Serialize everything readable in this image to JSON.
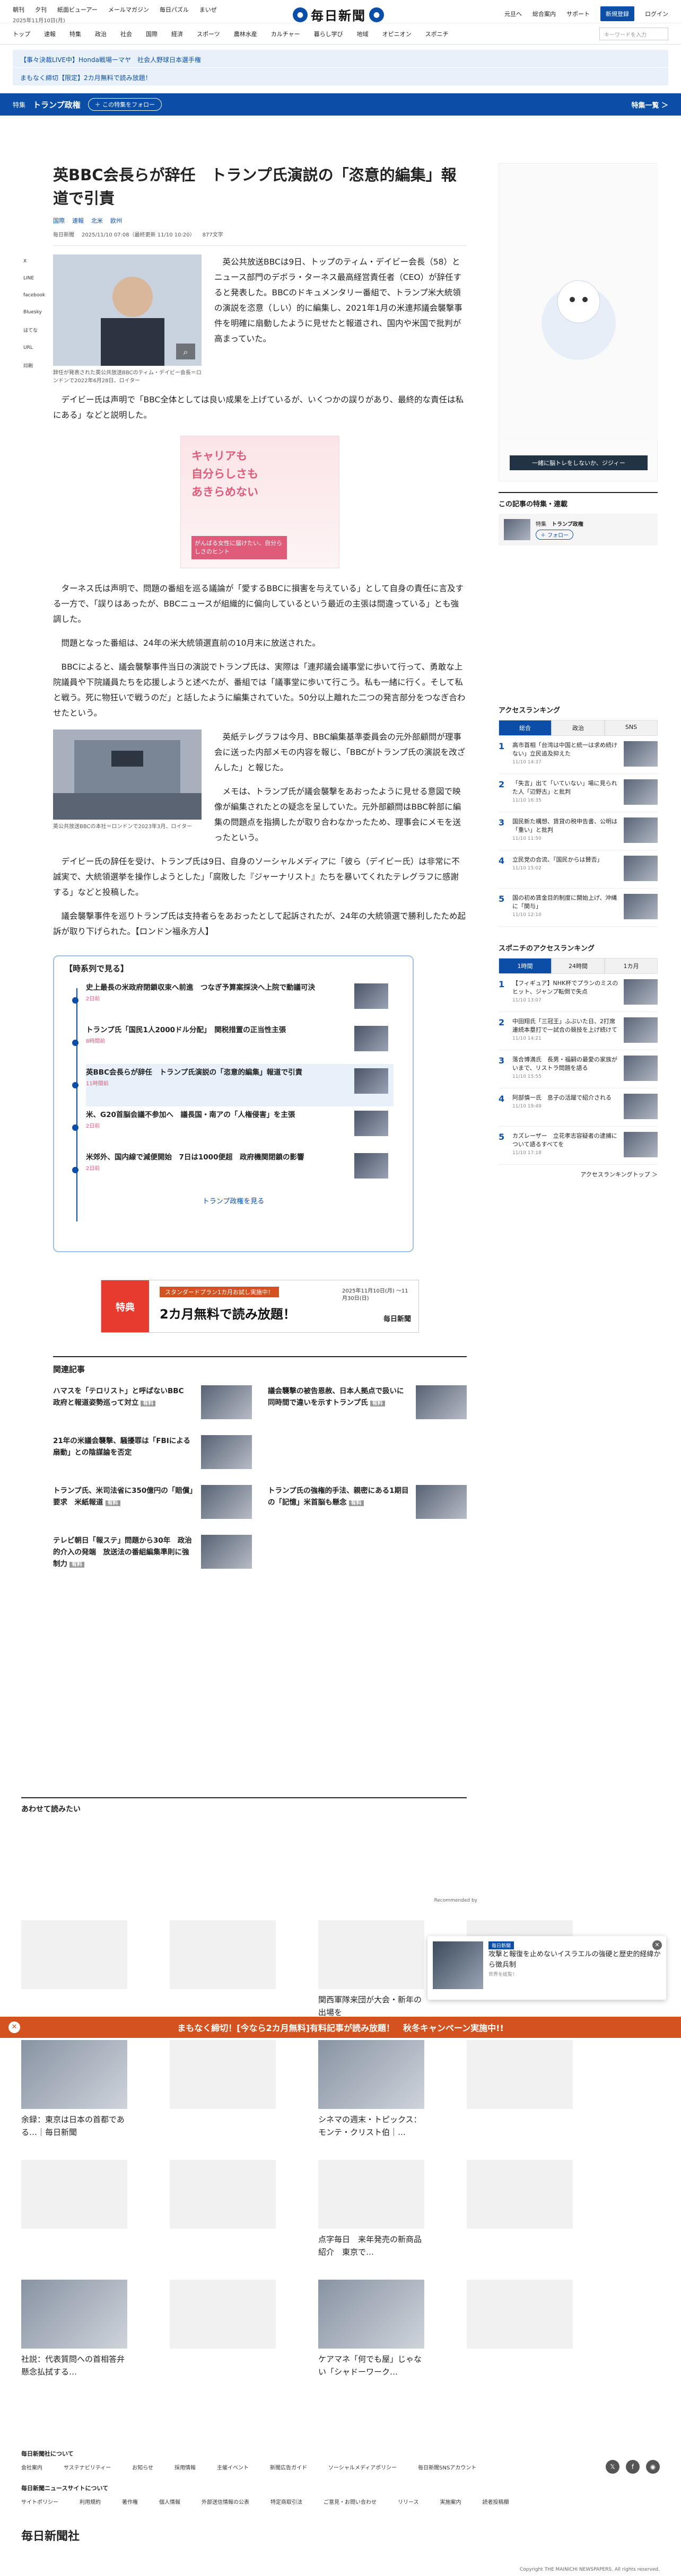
{
  "header": {
    "util_links": [
      "朝刊",
      "夕刊",
      "紙面ビューアー",
      "メールマガジン",
      "毎日パズル",
      "まいぜ"
    ],
    "date": "2025年11月10日(月)",
    "logo": "毎日新聞",
    "right_links": [
      "元旦へ",
      "総合案内",
      "サポート"
    ],
    "subscribe": "新規登録",
    "login": "ログイン"
  },
  "nav": {
    "items": [
      "トップ",
      "速報",
      "特集",
      "政治",
      "社会",
      "国際",
      "経済",
      "スポーツ",
      "農林水産",
      "カルチャー",
      "暮らし学び",
      "地域",
      "オピニオン",
      "スポニチ"
    ],
    "search_placeholder": "キーワードを入力"
  },
  "banners": [
    "【事々決裁LIVE中】Honda戦場ーマヤ　社会人野球日本選手権",
    "まもなく締切【限定】2カ月無料で読み放題！"
  ],
  "feature": {
    "tag": "特集",
    "title": "トランプ政権",
    "follow": "＋ この特集をフォロー",
    "more": "特集一覧 ＞"
  },
  "article": {
    "title": "英BBC会長らが辞任　トランプ氏演説の「恣意的編集」報道で引責",
    "categories": [
      "国際",
      "速報",
      "北米",
      "欧州"
    ],
    "meta": [
      "毎日新聞",
      "2025/11/10 07:08（最終更新 11/10 10:20）",
      "877文字"
    ],
    "share_icons": [
      "X",
      "LINE",
      "facebook",
      "Bluesky",
      "はてな",
      "URL",
      "印刷"
    ],
    "photo1_caption": "辞任が発表された英公共放送BBCのティム・デイビー会長＝ロンドンで2022年6月28日、ロイター",
    "p1": "英公共放送BBCは9日、トップのティム・デイビー会長（58）とニュース部門のデボラ・ターネス最高経営責任者（CEO）が辞任すると発表した。BBCのドキュメンタリー番組で、トランプ米大統領の演説を恣意（しい）的に編集し、2021年1月の米連邦議会襲撃事件を明確に扇動したように見せたと報道され、国内や米国で批判が高まっていた。",
    "p2": "デイビー氏は声明で「BBC全体としては良い成果を上げているが、いくつかの誤りがあり、最終的な責任は私にある」などと説明した。",
    "ad": {
      "line1": "キャリアも",
      "line2": "自分らしさも",
      "line3": "あきらめない",
      "sub": "がんばる女性に届けたい、自分らしさのヒント"
    },
    "p3": "ターネス氏は声明で、問題の番組を巡る議論が「愛するBBCに損害を与えている」として自身の責任に言及する一方で、「誤りはあったが、BBCニュースが組織的に偏向しているという最近の主張は間違っている」とも強調した。",
    "p4": "問題となった番組は、24年の米大統領選直前の10月末に放送された。",
    "p5": "BBCによると、議会襲撃事件当日の演説でトランプ氏は、実際は「連邦議会議事堂に歩いて行って、勇敢な上院議員や下院議員たちを応援しようと述べたが、番組では「議事堂に歩いて行こう。私も一緒に行く。そして私と戦う。死に物狂いで戦うのだ」と話したように編集されていた。50分以上離れた二つの発言部分をつなぎ合わせたという。",
    "photo2_caption": "英公共放送BBCの本社＝ロンドンで2023年3月、ロイター",
    "p6": "英紙テレグラフは今月、BBC編集基準委員会の元外部顧問が理事会に送った内部メモの内容を報じ、「BBCがトランプ氏の演説を改ざんした」と報じた。",
    "p7": "メモは、トランプ氏が議会襲撃をあおったように見せる意図で映像が編集されたとの疑念を呈していた。元外部顧問はBBC幹部に編集の問題点を指摘したが取り合わなかったため、理事会にメモを送ったという。",
    "p8": "デイビー氏の辞任を受け、トランプ氏は9日、自身のソーシャルメディアに「彼ら（デイビー氏）は非常に不誠実で、大統領選挙を操作しようとした」「腐敗した『ジャーナリスト』たちを暴いてくれたテレグラフに感謝する」などと投稿した。",
    "p9": "議会襲撃事件を巡りトランプ氏は支持者らをあおったとして起訴されたが、24年の大統領選で勝利したため起訴が取り下げられた。【ロンドン福永方人】"
  },
  "timeline": {
    "heading": "【時系列で見る】",
    "items": [
      {
        "title": "史上最長の米政府閉鎖収束へ前進　つなぎ予算案採決へ上院で動議可決",
        "date": "2日前"
      },
      {
        "title": "トランプ氏「国民1人2000ドル分配」　関税措置の正当性主張",
        "date": "8時間前"
      },
      {
        "title": "英BBC会長らが辞任　トランプ氏演説の「恣意的編集」報道で引責",
        "date": "11時間前"
      },
      {
        "title": "米、G20首脳会議不参加へ　議長国・南アの「人権侵害」を主張",
        "date": "2日前"
      },
      {
        "title": "米郊外、国内線で減便開始　7日は1000便超　政府機関閉鎖の影響",
        "date": "2日前"
      }
    ],
    "more": "トランプ政権を見る"
  },
  "promo": {
    "line1": "スタンダードプラン1カ月お試し実施中！",
    "line2": "2カ月無料で読み放題！",
    "badge": "特典",
    "period": "2025年11月10日(月) 〜11月30日(日)",
    "brand": "毎日新聞"
  },
  "related": {
    "heading": "関連記事",
    "items": [
      {
        "title": "ハマスを「テロリスト」と呼ばないBBC　政府と報道姿勢巡って対立",
        "badge": "有料"
      },
      {
        "title": "議会襲撃の被告恩赦、日本人拠点で扱いに同時間で違いを示すトランプ氏",
        "badge": "有料"
      },
      {
        "title": "21年の米議会襲撃、騒擾罪は「FBIによる扇動」との陰謀論を否定",
        "badge": ""
      },
      {
        "title": "",
        "badge": ""
      },
      {
        "title": "トランプ氏、米司法省に350億円の「賠償」要求　米紙報道",
        "badge": "有料"
      },
      {
        "title": "トランプ氏の強権的手法、親密にある1期目の「記憶」米首脳も懸念",
        "badge": "有料"
      },
      {
        "title": "テレビ朝日「報ステ」問題から30年　政治的介入の発端　放送法の番組編集準則に強制力",
        "badge": "有料"
      }
    ]
  },
  "sidebar": {
    "ad_label": "一緒に脳トレをしないか、ジジィー",
    "feature_heading": "この記事の特集・連載",
    "feature_tag": "特集",
    "feature_title": "トランプ政権",
    "feature_follow": "＋ フォロー",
    "ranking_heading": "アクセスランキング",
    "ranking_tabs": [
      "総合",
      "政治",
      "SNS"
    ],
    "ranking": [
      {
        "title": "高市首相「台湾は中国と統一は求め続けない」立民追及抑えた",
        "time": "11/10 14:37"
      },
      {
        "title": "「失言」出て「いていない」場に見られた人「辺野古」と批判",
        "time": "11/10 16:35"
      },
      {
        "title": "国民新た構想、賃貸の税申告書、公明は「重い」と批判",
        "time": "11/10 11:50"
      },
      {
        "title": "立民党の合流、「国民からは賛否」",
        "time": "11/10 15:02"
      },
      {
        "title": "国の初め賃金目的制度に開始上げ、沖縄に「関与」",
        "time": "11/10 12:10"
      }
    ],
    "sponichi_heading": "スポニチのアクセスランキング",
    "sponichi_tabs": [
      "1時間",
      "24時間",
      "1カ月"
    ],
    "sponichi": [
      {
        "title": "【フィギュア】NHK杯でプランのミスのヒット、ジャンプ転倒で失点",
        "time": "11/10 13:07"
      },
      {
        "title": "中田翔氏「三冠王」ふぶいた日、2打席連続本塁打で一試合の競技を上げ続けて",
        "time": "11/10 14:21"
      },
      {
        "title": "落合博満氏　長男・福嗣の最愛の家族がいまで、リストラ問題を語る",
        "time": "11/10 15:55"
      },
      {
        "title": "阿部慎一氏　息子の活躍で紹介される",
        "time": "11/10 19:49"
      },
      {
        "title": "カズレーザー　立花孝志容疑者の逮捕について語るすべてを",
        "time": "11/10 17:18"
      }
    ],
    "more": "アクセスランキングトップ ＞"
  },
  "recommended": {
    "heading": "あわせて読みたい",
    "sponsor": "Recommended by",
    "items": [
      {
        "title": "",
        "pic": false
      },
      {
        "title": "",
        "pic": false
      },
      {
        "title": "関西軍隊来団が大会・新年の出場を",
        "pic": false
      },
      {
        "title": "",
        "pic": false
      },
      {
        "title": "余録：東京は日本の首都である…｜毎日新聞",
        "pic": true
      },
      {
        "title": "",
        "pic": false
      },
      {
        "title": "シネマの週末・トピックス：モンテ・クリスト伯｜…",
        "pic": true
      },
      {
        "title": "",
        "pic": false
      },
      {
        "title": "",
        "pic": false
      },
      {
        "title": "",
        "pic": false
      },
      {
        "title": "点字毎日　来年発売の新商品紹介　東京で…",
        "pic": false
      },
      {
        "title": "",
        "pic": false
      },
      {
        "title": "社説：代表質問への首相答弁　懸念払拭する…",
        "pic": true
      },
      {
        "title": "",
        "pic": false
      },
      {
        "title": "ケアマネ「何でも屋」じゃない「シャドーワーク…",
        "pic": true
      },
      {
        "title": "",
        "pic": false
      }
    ]
  },
  "toast": {
    "label": "毎日新聞",
    "title": "攻撃と報復を止めないイスラエルの強硬と歴史的経緯から徴兵制",
    "source": "世界を総覧！"
  },
  "campaign": "まもなく締切！[今なら2カ月無料]有料記事が読み放題！　秋冬キャンペーン実施中!!",
  "footer": {
    "h1": "毎日新聞社について",
    "links1": [
      "会社案内",
      "サステナビリティー",
      "お知らせ",
      "採用情報",
      "主催イベント",
      "新聞広告ガイド",
      "ソーシャルメディアポリシー",
      "毎日新聞SNSアカウント"
    ],
    "h2": "毎日新聞ニュースサイトについて",
    "links2": [
      "サイトポリシー",
      "利用規約",
      "著作権",
      "個人情報",
      "外部送信情報の公表",
      "特定商取引法",
      "ご意見・お問い合わせ",
      "リリース",
      "実施案内",
      "読者投稿欄"
    ],
    "logo": "毎日新聞社",
    "copyright": "Copyright THE MAINICHI NEWSPAPERS. All rights reserved."
  }
}
